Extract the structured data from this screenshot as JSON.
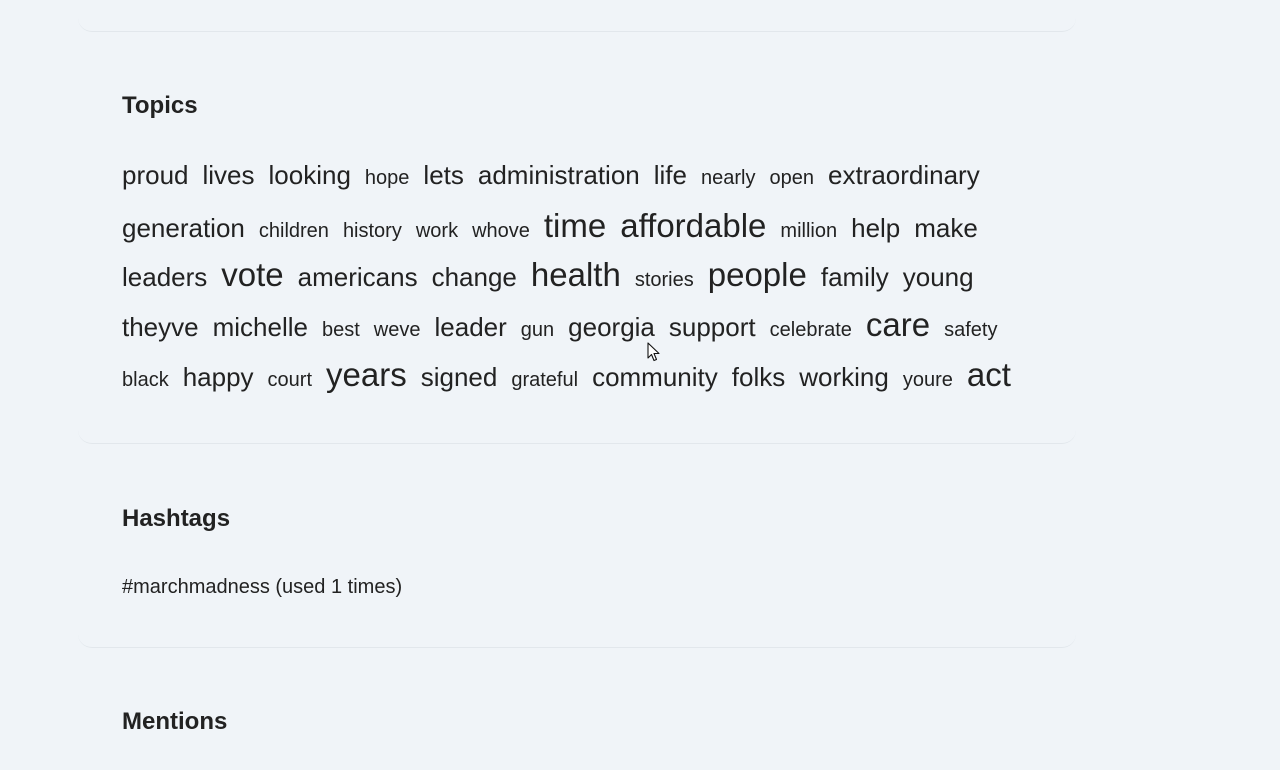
{
  "topics": {
    "title": "Topics",
    "rows": [
      [
        {
          "text": "proud",
          "size": 2
        },
        {
          "text": "lives",
          "size": 2
        },
        {
          "text": "looking",
          "size": 2
        },
        {
          "text": "hope",
          "size": 1
        },
        {
          "text": "lets",
          "size": 2
        },
        {
          "text": "administration",
          "size": 2
        },
        {
          "text": "life",
          "size": 2
        },
        {
          "text": "nearly",
          "size": 1
        },
        {
          "text": "open",
          "size": 1
        },
        {
          "text": "extraordinary",
          "size": 2
        }
      ],
      [
        {
          "text": "generation",
          "size": 2
        },
        {
          "text": "children",
          "size": 1
        },
        {
          "text": "history",
          "size": 1
        },
        {
          "text": "work",
          "size": 1
        },
        {
          "text": "whove",
          "size": 1
        },
        {
          "text": "time",
          "size": 3
        },
        {
          "text": "affordable",
          "size": 3
        },
        {
          "text": "million",
          "size": 1
        },
        {
          "text": "help",
          "size": 2
        },
        {
          "text": "make",
          "size": 2
        }
      ],
      [
        {
          "text": "leaders",
          "size": 2
        },
        {
          "text": "vote",
          "size": 3
        },
        {
          "text": "americans",
          "size": 2
        },
        {
          "text": "change",
          "size": 2
        },
        {
          "text": "health",
          "size": 3
        },
        {
          "text": "stories",
          "size": 1
        },
        {
          "text": "people",
          "size": 3
        },
        {
          "text": "family",
          "size": 2
        },
        {
          "text": "young",
          "size": 2
        }
      ],
      [
        {
          "text": "theyve",
          "size": 2
        },
        {
          "text": "michelle",
          "size": 2
        },
        {
          "text": "best",
          "size": 1
        },
        {
          "text": "weve",
          "size": 1
        },
        {
          "text": "leader",
          "size": 2
        },
        {
          "text": "gun",
          "size": 1
        },
        {
          "text": "georgia",
          "size": 2
        },
        {
          "text": "support",
          "size": 2
        },
        {
          "text": "celebrate",
          "size": 1
        },
        {
          "text": "care",
          "size": 3
        },
        {
          "text": "safety",
          "size": 1
        }
      ],
      [
        {
          "text": "black",
          "size": 1
        },
        {
          "text": "happy",
          "size": 2
        },
        {
          "text": "court",
          "size": 1
        },
        {
          "text": "years",
          "size": 3
        },
        {
          "text": "signed",
          "size": 2
        },
        {
          "text": "grateful",
          "size": 1
        },
        {
          "text": "community",
          "size": 2
        },
        {
          "text": "folks",
          "size": 2
        },
        {
          "text": "working",
          "size": 2
        },
        {
          "text": "youre",
          "size": 1
        },
        {
          "text": "act",
          "size": 3
        }
      ]
    ]
  },
  "hashtags": {
    "title": "Hashtags",
    "items": [
      "#marchmadness (used 1 times)"
    ]
  },
  "mentions": {
    "title": "Mentions"
  }
}
